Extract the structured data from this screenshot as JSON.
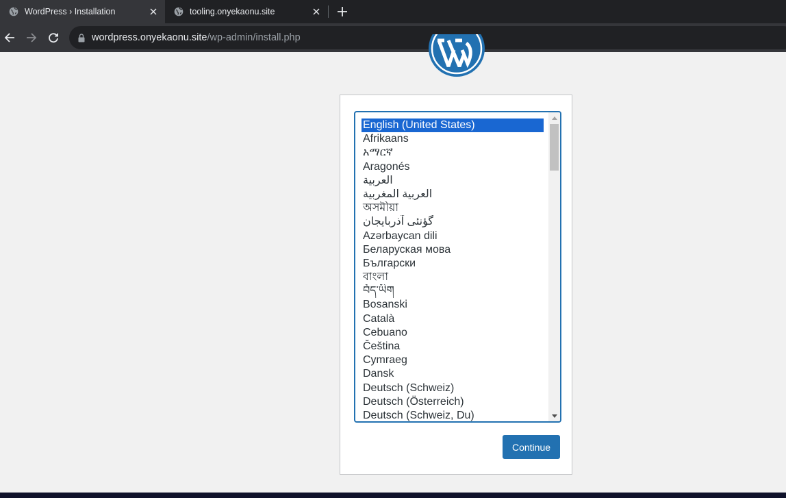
{
  "browser": {
    "tabs": [
      {
        "title": "WordPress › Installation",
        "active": true
      },
      {
        "title": "tooling.onyekaonu.site",
        "active": false
      }
    ],
    "address": {
      "host": "wordpress.onyekaonu.site",
      "path": "/wp-admin/install.php"
    }
  },
  "page": {
    "languages": [
      "English (United States)",
      "Afrikaans",
      "አማርኛ",
      "Aragonés",
      "العربية",
      "العربية المغربية",
      "অসমীয়া",
      "گؤنئی آذربایجان",
      "Azərbaycan dili",
      "Беларуская мова",
      "Български",
      "বাংলা",
      "བོད་ཡིག",
      "Bosanski",
      "Català",
      "Cebuano",
      "Čeština",
      "Cymraeg",
      "Dansk",
      "Deutsch (Schweiz)",
      "Deutsch (Österreich)",
      "Deutsch (Schweiz, Du)"
    ],
    "selected_language": "English (United States)",
    "continue_label": "Continue"
  },
  "colors": {
    "accent": "#2271b1",
    "selection": "#1967d2"
  }
}
